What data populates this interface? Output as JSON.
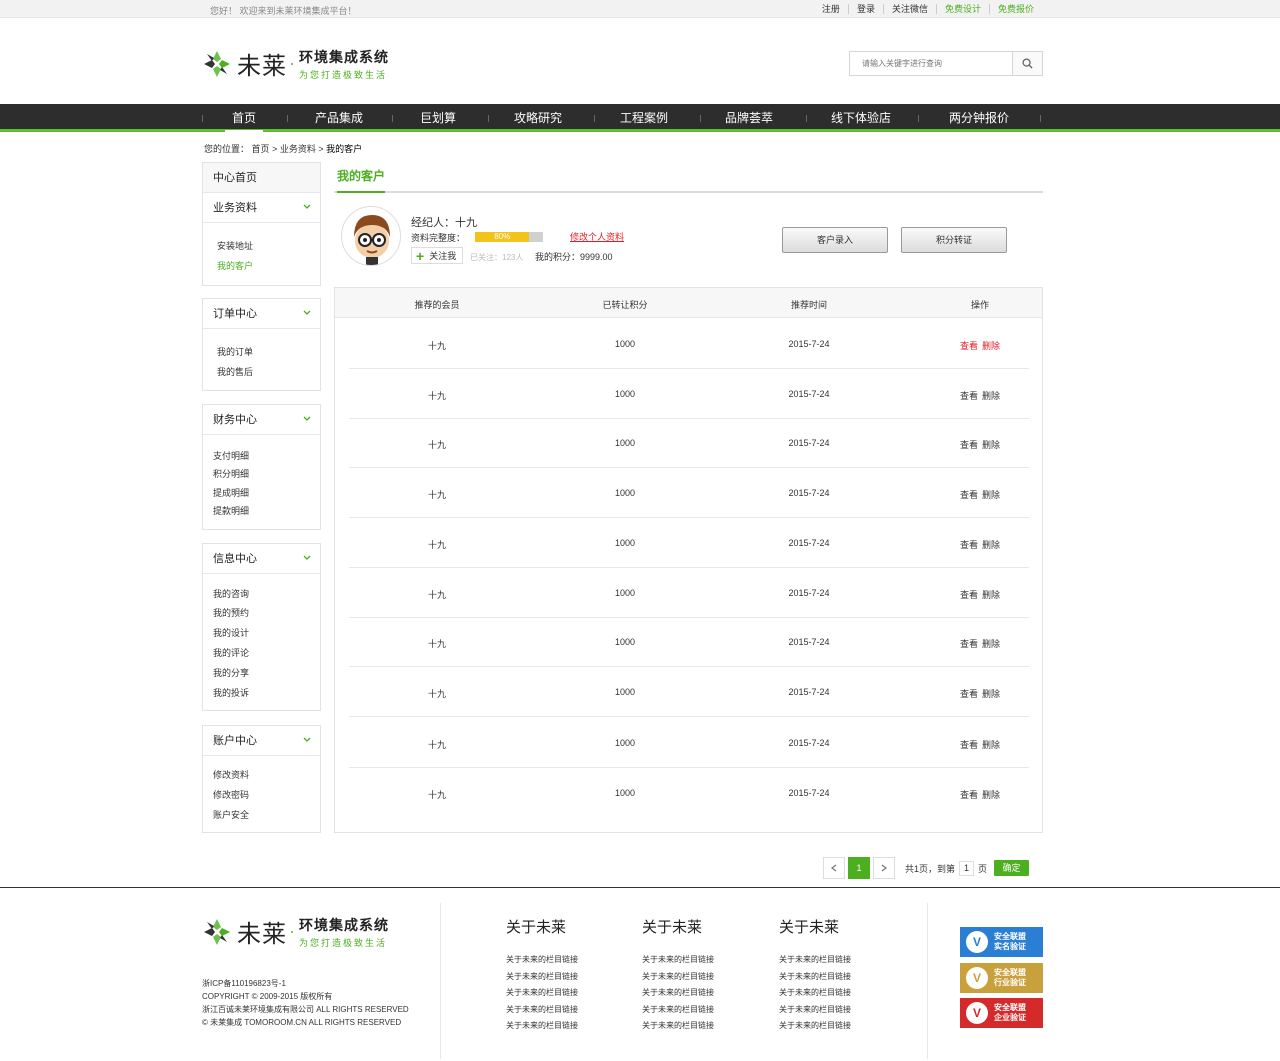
{
  "topbar": {
    "welcome": "您好！ 欢迎来到未莱环境集成平台！",
    "links": [
      "注册",
      "登录",
      "关注微信",
      "免费设计",
      "免费报价"
    ]
  },
  "header": {
    "brand": "未莱",
    "system_name": "环境集成系统",
    "slogan": "为您打造极致生活",
    "search_placeholder": "请输入关键字进行查询"
  },
  "nav": {
    "items": [
      "首页",
      "产品集成",
      "巨划算",
      "攻略研究",
      "工程案例",
      "品牌荟萃",
      "线下体验店",
      "两分钟报价"
    ],
    "active_index": 0
  },
  "breadcrumb": {
    "prefix": "您的位置：",
    "items": [
      "首页",
      "业务资料",
      "我的客户"
    ],
    "sep": ">"
  },
  "sidebar": {
    "home": "中心首页",
    "groups": [
      {
        "title": "业务资料",
        "items": [
          "安装地址",
          "我的客户"
        ],
        "active": "我的客户"
      },
      {
        "title": "订单中心",
        "items": [
          "我的订单",
          "我的售后"
        ]
      },
      {
        "title": "财务中心",
        "items": [
          "支付明细",
          "积分明细",
          "提成明细",
          "提款明细"
        ]
      },
      {
        "title": "信息中心",
        "items": [
          "我的咨询",
          "我的预约",
          "我的设计",
          "我的评论",
          "我的分享",
          "我的投诉"
        ]
      },
      {
        "title": "账户中心",
        "items": [
          "修改资料",
          "修改密码",
          "账户安全"
        ]
      }
    ]
  },
  "main": {
    "title": "我的客户",
    "profile": {
      "agent_label": "经纪人：十九",
      "complete_label": "资料完整度：",
      "complete_percent": 80,
      "complete_text": "80%",
      "edit_link": "修改个人资料",
      "follow_btn": "关注我",
      "followers": "已关注：123人",
      "points": "我的积分：9999.00"
    },
    "buttons": {
      "add_customer": "客户录入",
      "transfer_points": "积分转证"
    },
    "table": {
      "headers": [
        "推荐的会员",
        "已转让积分",
        "推荐时间",
        "操作"
      ],
      "rows": [
        [
          "十九",
          "1000",
          "2015-7-24"
        ],
        [
          "十九",
          "1000",
          "2015-7-24"
        ],
        [
          "十九",
          "1000",
          "2015-7-24"
        ],
        [
          "十九",
          "1000",
          "2015-7-24"
        ],
        [
          "十九",
          "1000",
          "2015-7-24"
        ],
        [
          "十九",
          "1000",
          "2015-7-24"
        ],
        [
          "十九",
          "1000",
          "2015-7-24"
        ],
        [
          "十九",
          "1000",
          "2015-7-24"
        ],
        [
          "十九",
          "1000",
          "2015-7-24"
        ],
        [
          "十九",
          "1000",
          "2015-7-24"
        ]
      ],
      "op_view": "查看",
      "op_delete": "删除",
      "highlight_row": 0
    },
    "pager": {
      "current": "1",
      "summary": "共1页，到第",
      "page_input": "1",
      "page_unit": "页",
      "go": "确定"
    }
  },
  "footer": {
    "brand": "未莱",
    "system_name": "环境集成系统",
    "slogan": "为您打造极致生活",
    "icp": "浙ICP备110196823号-1",
    "copyright": "COPYRIGHT © 2009-2015 版权所有",
    "company": "浙江百诚未莱环境集成有限公司 ALL RIGHTS RESERVED",
    "site": "© 未莱集成 TOMOROOM.CN ALL RIGHTS RESERVED",
    "columns": [
      {
        "title": "关于未莱",
        "links": [
          "关于未来的栏目链接",
          "关于未来的栏目链接",
          "关于未来的栏目链接",
          "关于未来的栏目链接",
          "关于未来的栏目链接"
        ]
      },
      {
        "title": "关于未莱",
        "links": [
          "关于未来的栏目链接",
          "关于未来的栏目链接",
          "关于未来的栏目链接",
          "关于未来的栏目链接",
          "关于未来的栏目链接"
        ]
      },
      {
        "title": "关于未莱",
        "links": [
          "关于未来的栏目链接",
          "关于未来的栏目链接",
          "关于未来的栏目链接",
          "关于未来的栏目链接",
          "关于未来的栏目链接"
        ]
      }
    ],
    "badges": [
      {
        "l1": "安全联盟",
        "l2": "实名验证",
        "color": "#2a7fd4"
      },
      {
        "l1": "安全联盟",
        "l2": "行业验证",
        "color": "#c9a13c"
      },
      {
        "l1": "安全联盟",
        "l2": "企业验证",
        "color": "#d42a2a"
      }
    ]
  },
  "colors": {
    "accent": "#4caf1f",
    "nav_bg": "#2d2d2d",
    "danger": "#e51c23",
    "progress": "#f2c31b"
  }
}
